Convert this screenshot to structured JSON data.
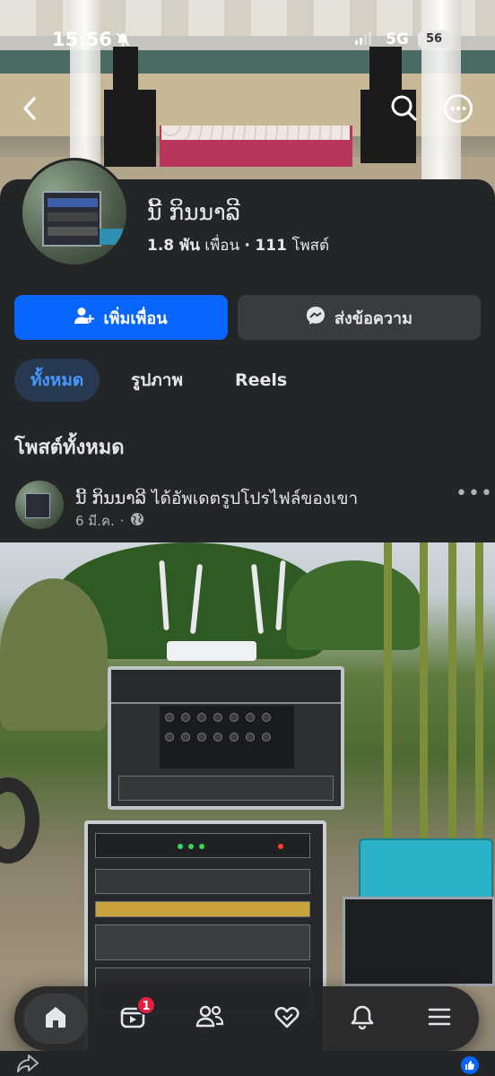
{
  "status_bar": {
    "time": "15:56",
    "network": "5G",
    "battery": "56"
  },
  "profile": {
    "name": "ນີ້ ກິນນາລີ",
    "friends_count": "1.8 พัน",
    "friends_label": "เพื่อน",
    "separator": "·",
    "posts_count": "111",
    "posts_label": "โพสต์"
  },
  "actions": {
    "add_friend": "เพิ่มเพื่อน",
    "message": "ส่งข้อความ"
  },
  "tabs": [
    {
      "label": "ทั้งหมด",
      "active": true
    },
    {
      "label": "รูปภาพ",
      "active": false
    },
    {
      "label": "Reels",
      "active": false
    }
  ],
  "section_title": "โพสต์ทั้งหมด",
  "post": {
    "author": "ນີ້ ກິນນາລີ",
    "action": "ได้อัพเดตรูปโปรไฟล์ของเขา",
    "date": "6 มี.ค.",
    "dot": "·",
    "privacy_icon": "globe-icon",
    "more": "•••"
  },
  "bottom_nav": {
    "items": [
      "home-icon",
      "video-icon",
      "friends-icon",
      "dating-icon",
      "bell-icon",
      "menu-icon"
    ],
    "video_badge": "1"
  },
  "colors": {
    "accent": "#0866ff",
    "background": "#242526",
    "secondary_button": "#3a3b3c",
    "active_tab_text": "#4599ff",
    "badge": "#e41e3f"
  }
}
